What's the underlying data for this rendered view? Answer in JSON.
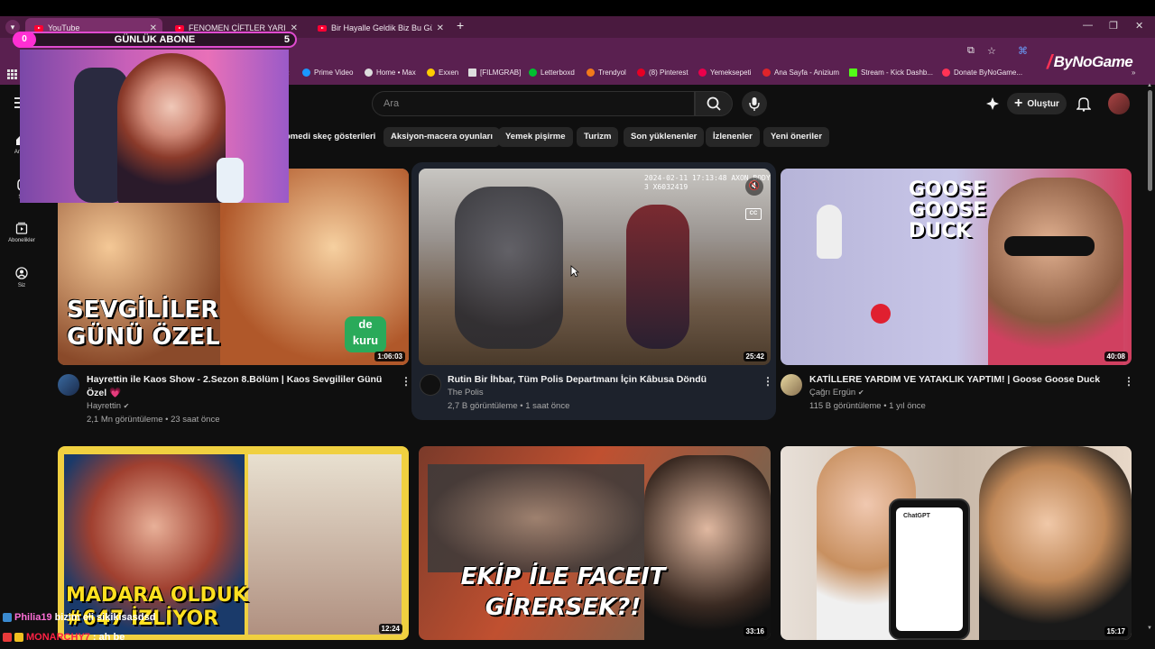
{
  "browser": {
    "tabs": [
      {
        "label": "YouTube",
        "active": true
      },
      {
        "label": "FENOMEN ÇİFTLER YARIŞIYOR",
        "active": false
      },
      {
        "label": "Bir Hayalle Geldik Biz Bu Günle",
        "active": false
      }
    ],
    "bookmarks": [
      {
        "label": "Prime Video",
        "color": "#1a98ff"
      },
      {
        "label": "Home • Max",
        "color": "#dddddd"
      },
      {
        "label": "Exxen",
        "color": "#ffcc00"
      },
      {
        "label": "[FILMGRAB]",
        "color": "#dddddd"
      },
      {
        "label": "Letterboxd",
        "color": "#00c030"
      },
      {
        "label": "Trendyol",
        "color": "#f27a1a"
      },
      {
        "label": "(8) Pinterest",
        "color": "#e60023"
      },
      {
        "label": "Yemeksepeti",
        "color": "#ea004b"
      },
      {
        "label": "Ana Sayfa - Anizium",
        "color": "#e0242a"
      },
      {
        "label": "Stream - Kick Dashb...",
        "color": "#53fc18"
      },
      {
        "label": "Donate ByNoGame...",
        "color": "#ff3355"
      }
    ]
  },
  "overlay": {
    "sub_widget": {
      "left": "0",
      "label": "GÜNLÜK ABONE",
      "right": "5"
    },
    "logo": "ByNoGame"
  },
  "youtube": {
    "search_placeholder": "Ara",
    "create_label": "Oluştur",
    "chips": [
      "omedi skeç gösterileri",
      "Aksiyon-macera oyunları",
      "Yemek pişirme",
      "Turizm",
      "Son yüklenenler",
      "İzlenenler",
      "Yeni öneriler"
    ],
    "sidebar": [
      {
        "label": "Ana S",
        "icon": "home-icon"
      },
      {
        "label": "Sh",
        "icon": "shorts-icon"
      },
      {
        "label": "Abonelikler",
        "icon": "subscriptions-icon"
      },
      {
        "label": "Siz",
        "icon": "you-icon"
      }
    ],
    "videos": [
      {
        "title": "Hayrettin ile Kaos Show - 2.Sezon 8.Bölüm | Kaos Sevgililer Günü Özel 💗",
        "channel": "Hayrettin",
        "verified": true,
        "meta": "2,1 Mn görüntüleme • 23 saat önce",
        "duration": "1:06:03",
        "overlay": "SEVGİLİLER GÜNÜ ÖZEL"
      },
      {
        "title": "Rutin Bir İhbar, Tüm Polis Departmanı İçin Kâbusa Döndü",
        "channel": "The Polis",
        "verified": false,
        "meta": "2,7 B görüntüleme • 1 saat önce",
        "duration": "25:42",
        "overlay": "2024-02-11 17:13:48 AXON BODY 3 X6032419"
      },
      {
        "title": "KATİLLERE YARDIM VE YATAKLIK YAPTIM! | Goose Goose Duck",
        "channel": "Çağrı Ergün",
        "verified": true,
        "meta": "115 B görüntüleme • 1 yıl önce",
        "duration": "40:08",
        "overlay": "GOOSE GOOSE DUCK"
      },
      {
        "duration": "12:24",
        "overlay": "MADARA OLDUK #647 İZLİYOR"
      },
      {
        "duration": "33:16",
        "overlay": "EKİP İLE FACEIT GİRERSEK?!"
      },
      {
        "duration": "15:17",
        "overlay": "ChatGPT"
      }
    ]
  },
  "chat": [
    {
      "user": "Philia19",
      "message": "bizim eli sikikisasdsd",
      "color": "#ff6fd8"
    },
    {
      "user": "MONARCHY7",
      "message": ": ah be",
      "color": "#ff2244"
    }
  ]
}
